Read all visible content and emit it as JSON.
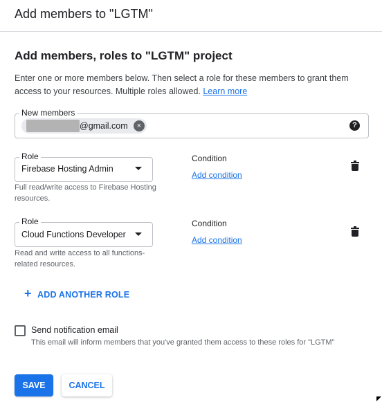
{
  "dialog": {
    "title": "Add members to \"LGTM\""
  },
  "section": {
    "title": "Add members, roles to \"LGTM\" project",
    "intro": "Enter one or more members below. Then select a role for these members to grant them access to your resources. Multiple roles allowed.",
    "learn_more": "Learn more"
  },
  "members": {
    "label": "New members",
    "chip_text": "@gmail.com",
    "chip_remove_icon": "×",
    "help_icon": "?"
  },
  "roles": [
    {
      "label": "Role",
      "value": "Firebase Hosting Admin",
      "description": "Full read/write access to Firebase Hosting resources.",
      "condition_label": "Condition",
      "condition_link": "Add condition"
    },
    {
      "label": "Role",
      "value": "Cloud Functions Developer",
      "description": "Read and write access to all functions-related resources.",
      "condition_label": "Condition",
      "condition_link": "Add condition"
    }
  ],
  "add_role": {
    "icon": "+",
    "label": "ADD ANOTHER ROLE"
  },
  "notification": {
    "label": "Send notification email",
    "help": "This email will inform members that you've granted them access to these roles for \"LGTM\""
  },
  "buttons": {
    "save": "SAVE",
    "cancel": "CANCEL"
  },
  "colors": {
    "accent": "#1a73e8",
    "text": "#202124",
    "muted": "#5f6368",
    "border": "#dadce0"
  }
}
